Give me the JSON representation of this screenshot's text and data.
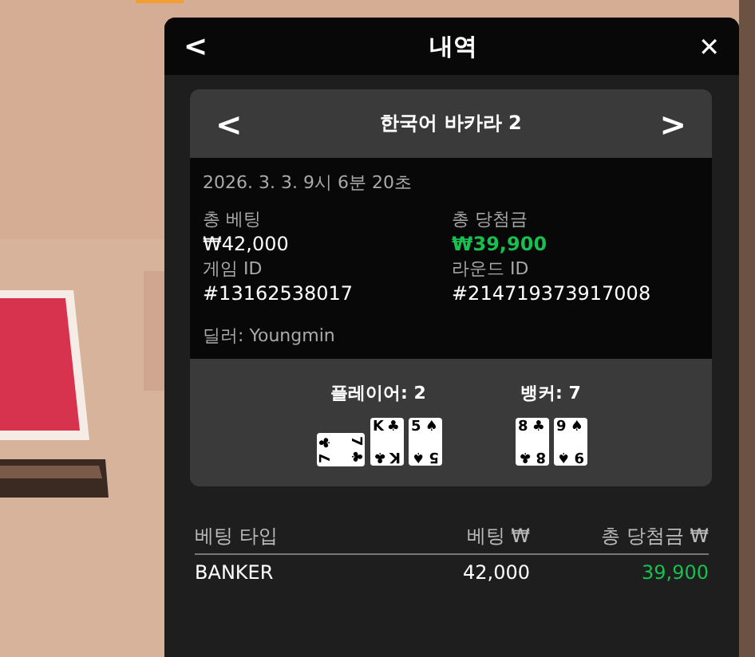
{
  "panel": {
    "back": "<",
    "title": "내역",
    "close": "✕"
  },
  "game": {
    "prev": "<",
    "name": "한국어 바카라 2",
    "next": ">"
  },
  "info": {
    "datetime": "2026. 3. 3. 9시 6분 20초",
    "fields": [
      {
        "label": "총 베팅",
        "value": "₩42,000",
        "kind": "plain"
      },
      {
        "label": "총 당첨금",
        "value": "₩39,900",
        "kind": "win"
      },
      {
        "label": "게임 ID",
        "value": "#13162538017",
        "kind": "plain"
      },
      {
        "label": "라운드 ID",
        "value": "#214719373917008",
        "kind": "plain"
      }
    ],
    "dealer": "딜러: Youngmin"
  },
  "hands": [
    {
      "label": "플레이어: 2",
      "cards": [
        {
          "sideways": true,
          "corners": [
            {
              "rank": "7",
              "suit": "♣"
            },
            {
              "rank": "7",
              "suit": "♣"
            }
          ]
        },
        {
          "sideways": false,
          "corners": [
            {
              "rank": "K",
              "suit": "♣"
            },
            {
              "rank": "K",
              "suit": "♣"
            }
          ]
        },
        {
          "sideways": false,
          "corners": [
            {
              "rank": "5",
              "suit": "♠"
            },
            {
              "rank": "5",
              "suit": "♠"
            }
          ]
        }
      ]
    },
    {
      "label": "뱅커: 7",
      "cards": [
        {
          "sideways": false,
          "corners": [
            {
              "rank": "8",
              "suit": "♣"
            },
            {
              "rank": "8",
              "suit": "♣"
            }
          ]
        },
        {
          "sideways": false,
          "corners": [
            {
              "rank": "9",
              "suit": "♠"
            },
            {
              "rank": "9",
              "suit": "♠"
            }
          ]
        }
      ]
    }
  ],
  "table": {
    "columns": [
      "베팅 타입",
      "베팅 ₩",
      "총 당첨금 ₩"
    ],
    "rows": [
      {
        "cells": [
          "BANKER",
          "42,000",
          "39,900"
        ]
      }
    ]
  }
}
